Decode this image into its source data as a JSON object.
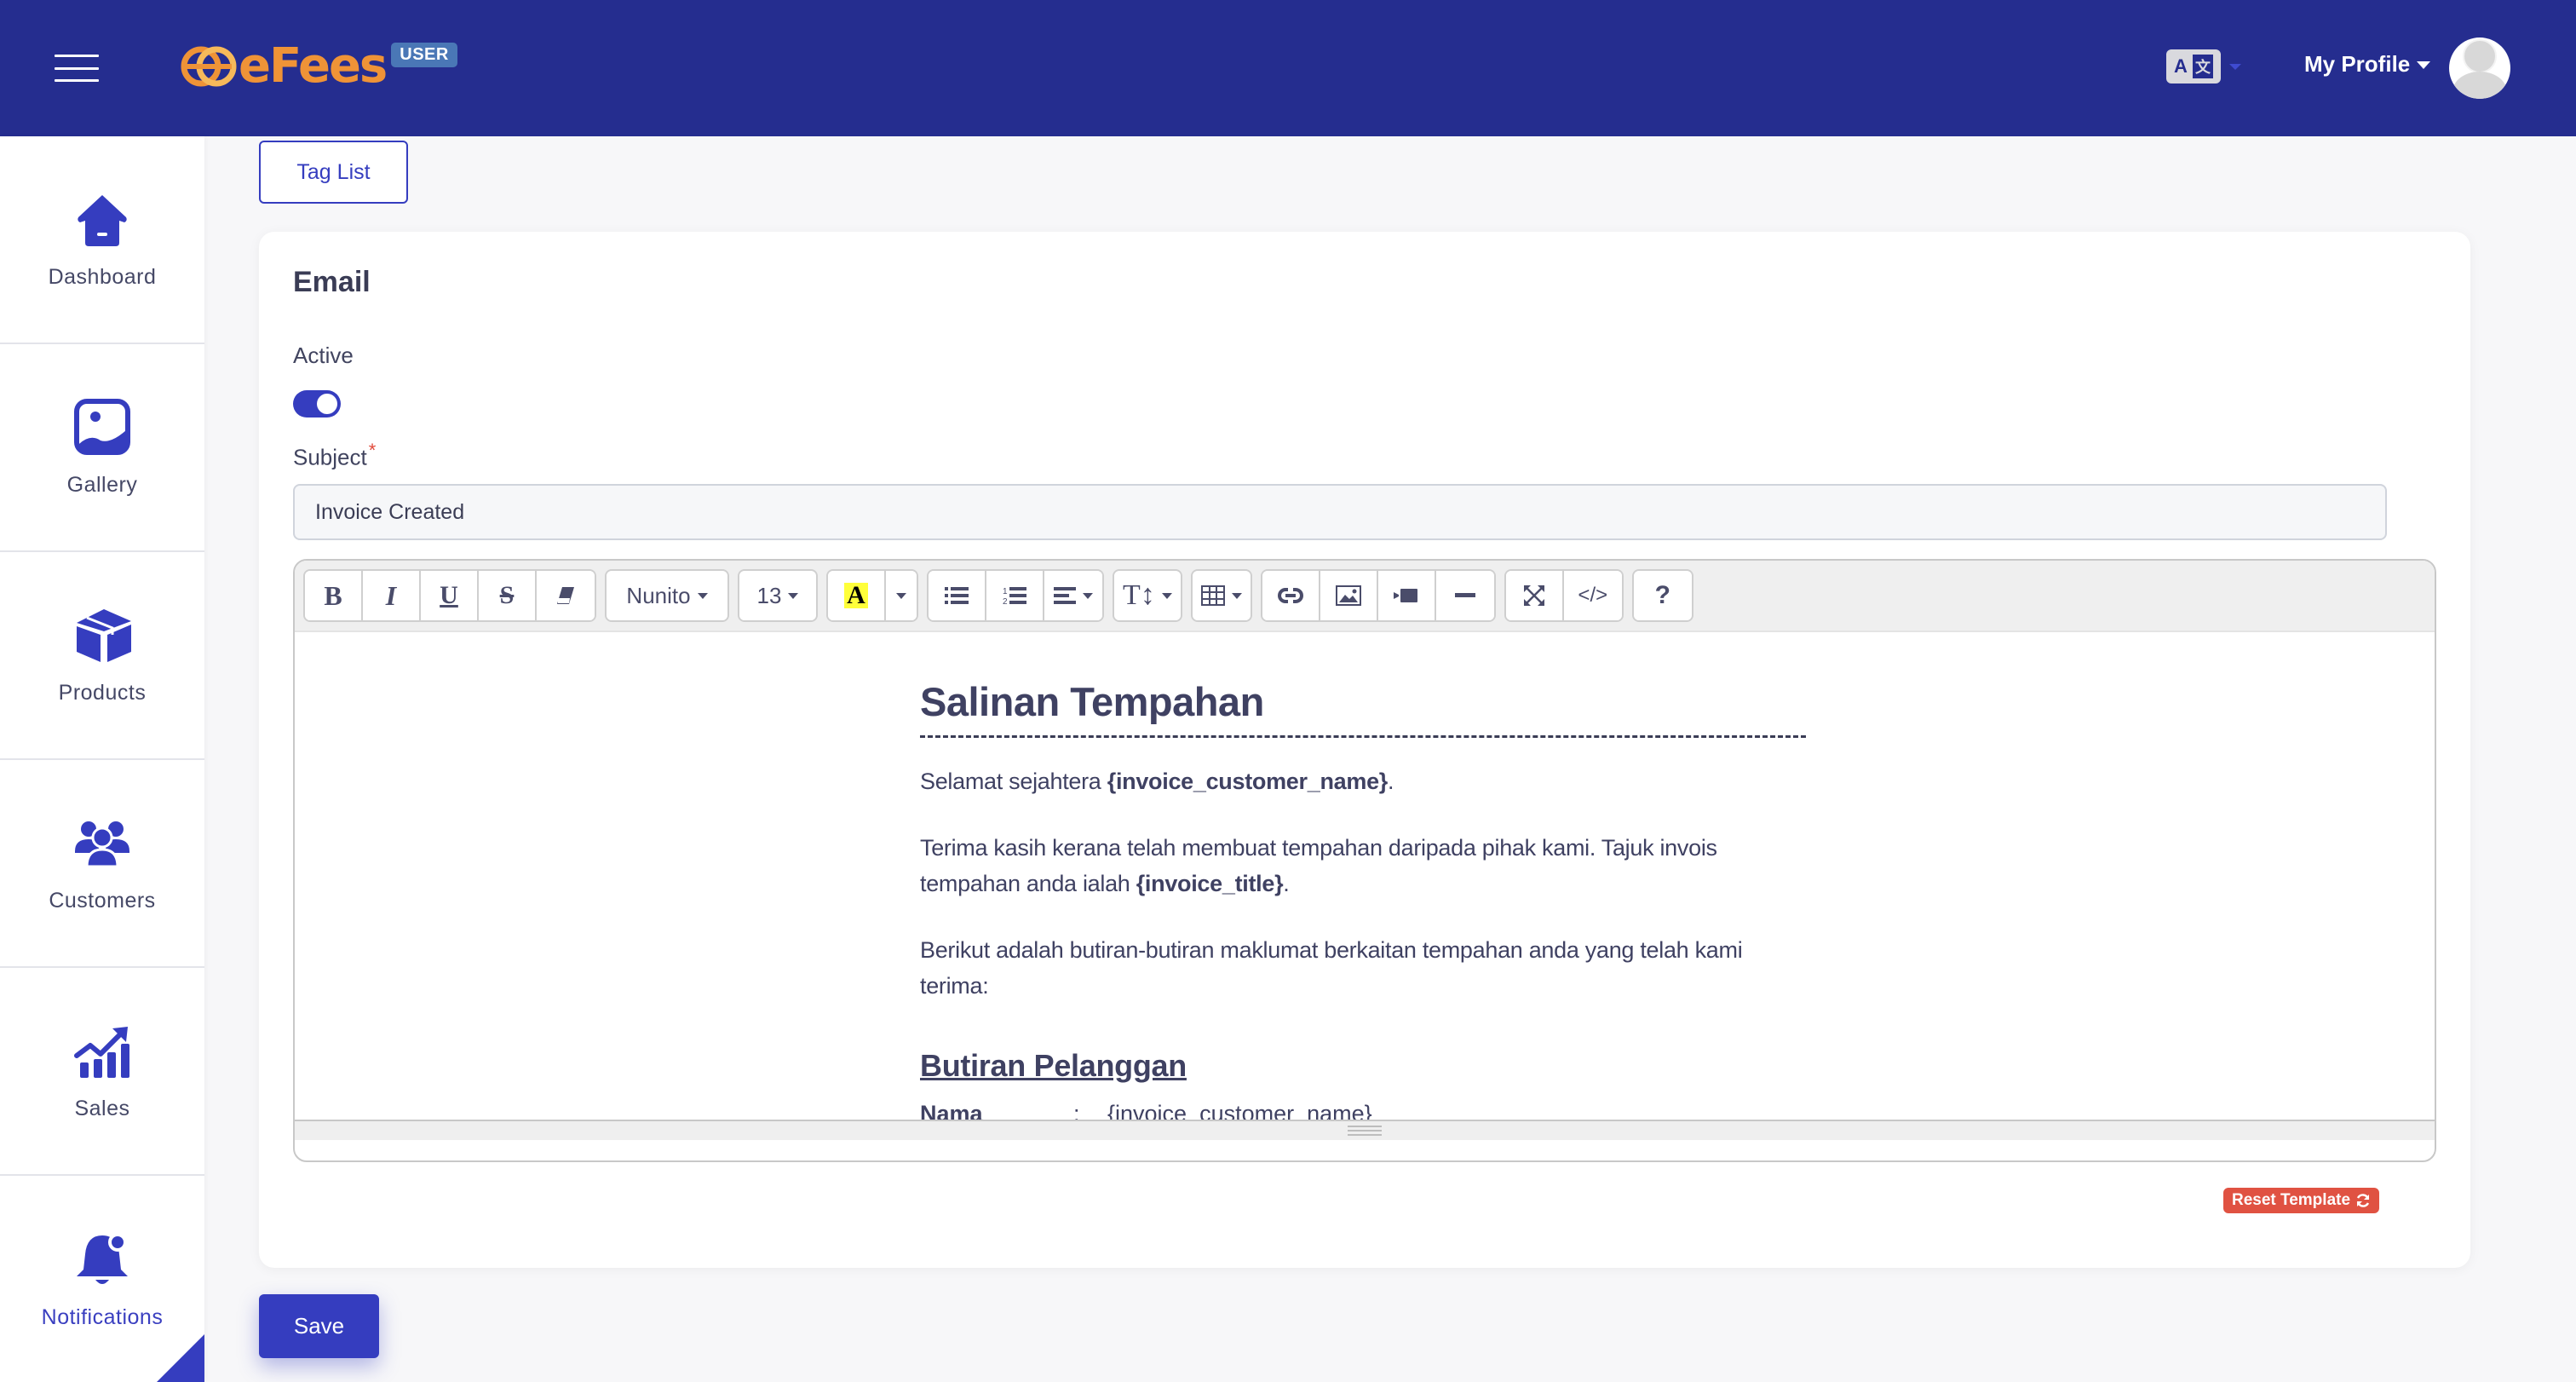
{
  "header": {
    "brand_name": "eFees",
    "brand_badge": "USER",
    "language_icon": "translate-icon",
    "profile_label": "My Profile",
    "colors": {
      "header_bg": "#252d8f",
      "brand_orange": "#ef9337",
      "badge_blue": "#4a77b6"
    }
  },
  "sidebar": {
    "items": [
      {
        "label": "Dashboard",
        "icon": "home-icon",
        "active": false
      },
      {
        "label": "Gallery",
        "icon": "image-icon",
        "active": false
      },
      {
        "label": "Products",
        "icon": "box-icon",
        "active": false
      },
      {
        "label": "Customers",
        "icon": "users-icon",
        "active": false
      },
      {
        "label": "Sales",
        "icon": "chart-growth-icon",
        "active": false
      },
      {
        "label": "Notifications",
        "icon": "bell-icon",
        "active": true
      }
    ],
    "accent_color": "#353dbf"
  },
  "main": {
    "tag_list_label": "Tag List",
    "card_title": "Email",
    "active_label": "Active",
    "active_toggle_on": true,
    "subject_label": "Subject",
    "subject_required_mark": "*",
    "subject_value": "Invoice Created",
    "editor": {
      "toolbar": {
        "bold": "B",
        "italic": "I",
        "underline": "U",
        "strikethrough": "S",
        "font_family": "Nunito",
        "font_size": "13",
        "highlight": "A",
        "help": "?",
        "code_view": "</>"
      },
      "content": {
        "title": "Salinan Tempahan",
        "greeting_prefix": "Selamat sejahtera ",
        "greeting_tag": "{invoice_customer_name}",
        "greeting_suffix": ".",
        "thanks_prefix": "Terima kasih kerana telah membuat tempahan daripada pihak kami. Tajuk invois tempahan anda ialah ",
        "thanks_tag": "{invoice_title}",
        "thanks_suffix": ".",
        "details_intro": "Berikut adalah butiran-butiran maklumat berkaitan tempahan anda yang telah kami terima:",
        "section_title": "Butiran Pelanggan",
        "rows": [
          {
            "key": "Nama",
            "separator": ":",
            "value": "{invoice_customer_name}"
          }
        ]
      }
    },
    "reset_template_label": "Reset Template",
    "save_label": "Save",
    "colors": {
      "primary": "#353dbf",
      "danger": "#e05242"
    }
  }
}
